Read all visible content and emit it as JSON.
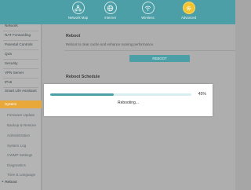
{
  "colors": {
    "accent": "#4c9fa6",
    "active_nav": "#f2c32f",
    "active_sidebar": "#e8a83a"
  },
  "topnav": [
    {
      "label": "Network Map",
      "icon": "network-map-icon",
      "active": false
    },
    {
      "label": "Internet",
      "icon": "globe-icon",
      "active": false
    },
    {
      "label": "Wireless",
      "icon": "wifi-icon",
      "active": false
    },
    {
      "label": "Advanced",
      "icon": "gear-icon",
      "active": true
    }
  ],
  "sidebar": {
    "items": [
      {
        "label": "Network"
      },
      {
        "label": "NAT Forwarding"
      },
      {
        "label": "Parental Controls"
      },
      {
        "label": "QoS"
      },
      {
        "label": "Security"
      },
      {
        "label": "VPN Server"
      },
      {
        "label": "IPv6"
      },
      {
        "label": "Smart Life Assistant"
      },
      {
        "label": "System",
        "active": true
      }
    ],
    "subitems": [
      {
        "label": "Firmware Update"
      },
      {
        "label": "Backup & Restore"
      },
      {
        "label": "Administration"
      },
      {
        "label": "System Log"
      },
      {
        "label": "CWMP Settings"
      },
      {
        "label": "Diagnostics"
      },
      {
        "label": "Time & Language"
      }
    ],
    "reboot_link": "Reboot"
  },
  "reboot": {
    "title": "Reboot",
    "description": "Reboot to clear cache and enhance running performance.",
    "button": "REBOOT"
  },
  "schedule": {
    "title": "Reboot Schedule"
  },
  "overlay": {
    "progress": 0.45,
    "percent_label": "45%",
    "status": "Rebooting..."
  }
}
